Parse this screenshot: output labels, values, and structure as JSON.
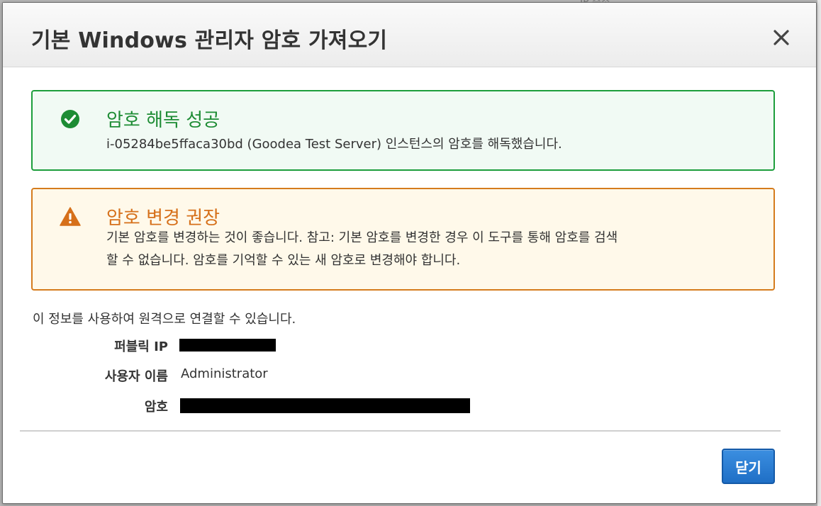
{
  "backdrop": {
    "partial_text": "IP 주소"
  },
  "dialog": {
    "title": "기본 Windows 관리자 암호 가져오기",
    "close_symbol": "×"
  },
  "success_alert": {
    "title": "암호 해독 성공",
    "message": "i-05284be5ffaca30bd (Goodea Test Server) 인스턴스의 암호를 해독했습니다.",
    "icon": "check-circle-icon",
    "color": "#1d8c34"
  },
  "warning_alert": {
    "title": "암호 변경 권장",
    "message_line1": "기본 암호를 변경하는 것이 좋습니다. 참고: 기본 암호를 변경한 경우 이 도구를 통해 암호를 검색",
    "message_line2": "할 수 없습니다. 암호를 기억할 수 있는 새 암호로 변경해야 합니다.",
    "icon": "warning-triangle-icon",
    "color": "#d6701a"
  },
  "connection_info": {
    "intro": "이 정보를 사용하여 원격으로 연결할 수 있습니다.",
    "public_ip_label": "퍼블릭 IP",
    "username_label": "사용자 이름",
    "username_value": "Administrator",
    "password_label": "암호"
  },
  "footer": {
    "close_button_label": "닫기",
    "button_color": "#1f6fc6"
  }
}
